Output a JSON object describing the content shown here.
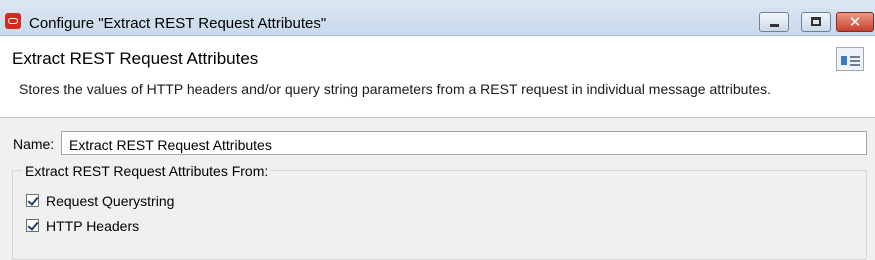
{
  "window": {
    "title": "Configure \"Extract REST Request Attributes\"",
    "controls": {
      "minimize": "minimize-icon",
      "maximize": "maximize-icon",
      "close": "✕"
    }
  },
  "header": {
    "title": "Extract REST Request Attributes",
    "description": "Stores the values of HTTP headers and/or query string parameters from a REST request in individual message attributes."
  },
  "form": {
    "name_label": "Name:",
    "name_value": "Extract REST Request Attributes",
    "group_label": "Extract REST Request Attributes From:",
    "options": [
      {
        "label": "Request Querystring",
        "checked": true
      },
      {
        "label": "HTTP Headers",
        "checked": true
      }
    ]
  }
}
